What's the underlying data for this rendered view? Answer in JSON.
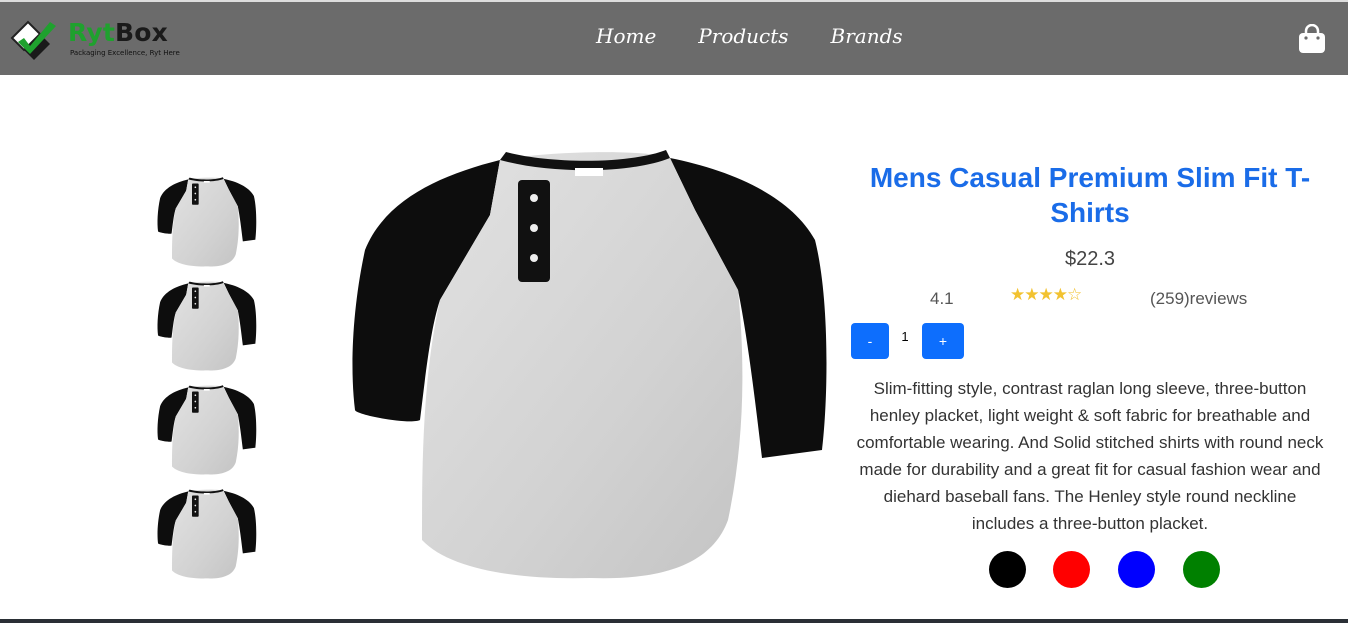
{
  "brand": {
    "name_part1": "Ryt",
    "name_part2": "Box",
    "tagline": "Packaging Excellence, Ryt Here",
    "logo_icon": "checkmark-box-logo-icon"
  },
  "nav": {
    "links": [
      {
        "label": "Home"
      },
      {
        "label": "Products"
      },
      {
        "label": "Brands"
      }
    ],
    "cart_icon": "shopping-bag-icon"
  },
  "product": {
    "title": "Mens Casual Premium Slim Fit T-Shirts",
    "price": "$22.3",
    "rating": "4.1",
    "rating_value": 4.1,
    "stars_text": "★★★★☆",
    "reviews": "(259)reviews",
    "quantity": "1",
    "minus_label": "-",
    "plus_label": "+",
    "description": "Slim-fitting style, contrast raglan long sleeve, three-button henley placket, light weight & soft fabric for breathable and comfortable wearing. And Solid stitched shirts with round neck made for durability and a great fit for casual fashion wear and diehard baseball fans. The Henley style round neckline includes a three-button placket.",
    "colors": [
      "#000000",
      "#ff0000",
      "#0000ff",
      "#008000"
    ],
    "thumbnail_count": 4
  },
  "theme": {
    "navbar_bg": "#6b6b6b",
    "accent": "#1a6ce8",
    "button": "#0d6efd",
    "star": "#f2c230"
  }
}
